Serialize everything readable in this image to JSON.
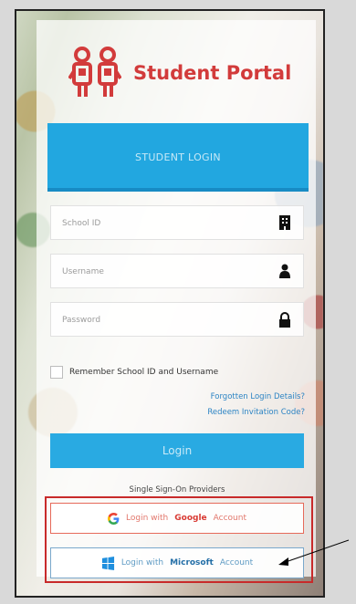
{
  "header": {
    "title": "Student Portal",
    "login_tab": "STUDENT LOGIN"
  },
  "fields": {
    "school_id_placeholder": "School ID",
    "username_placeholder": "Username",
    "password_placeholder": "Password"
  },
  "remember": {
    "label": "Remember School ID and Username"
  },
  "links": {
    "forgotten": "Forgotten Login Details?",
    "redeem": "Redeem Invitation Code?"
  },
  "login": {
    "button": "Login"
  },
  "sso": {
    "title": "Single Sign-On Providers",
    "google_prefix": "Login with",
    "google_brand": "Google",
    "google_suffix": "Account",
    "microsoft_prefix": "Login with",
    "microsoft_brand": "Microsoft",
    "microsoft_suffix": "Account"
  },
  "colors": {
    "brand_red": "#d23b3b",
    "accent_blue": "#22a7e0",
    "annotation_red": "#c82a2a"
  },
  "icons": {
    "logo": "student-logo-icon",
    "school": "building-icon",
    "user": "user-icon",
    "lock": "lock-icon",
    "google": "google-icon",
    "microsoft": "microsoft-icon",
    "arrow": "arrow-icon"
  }
}
